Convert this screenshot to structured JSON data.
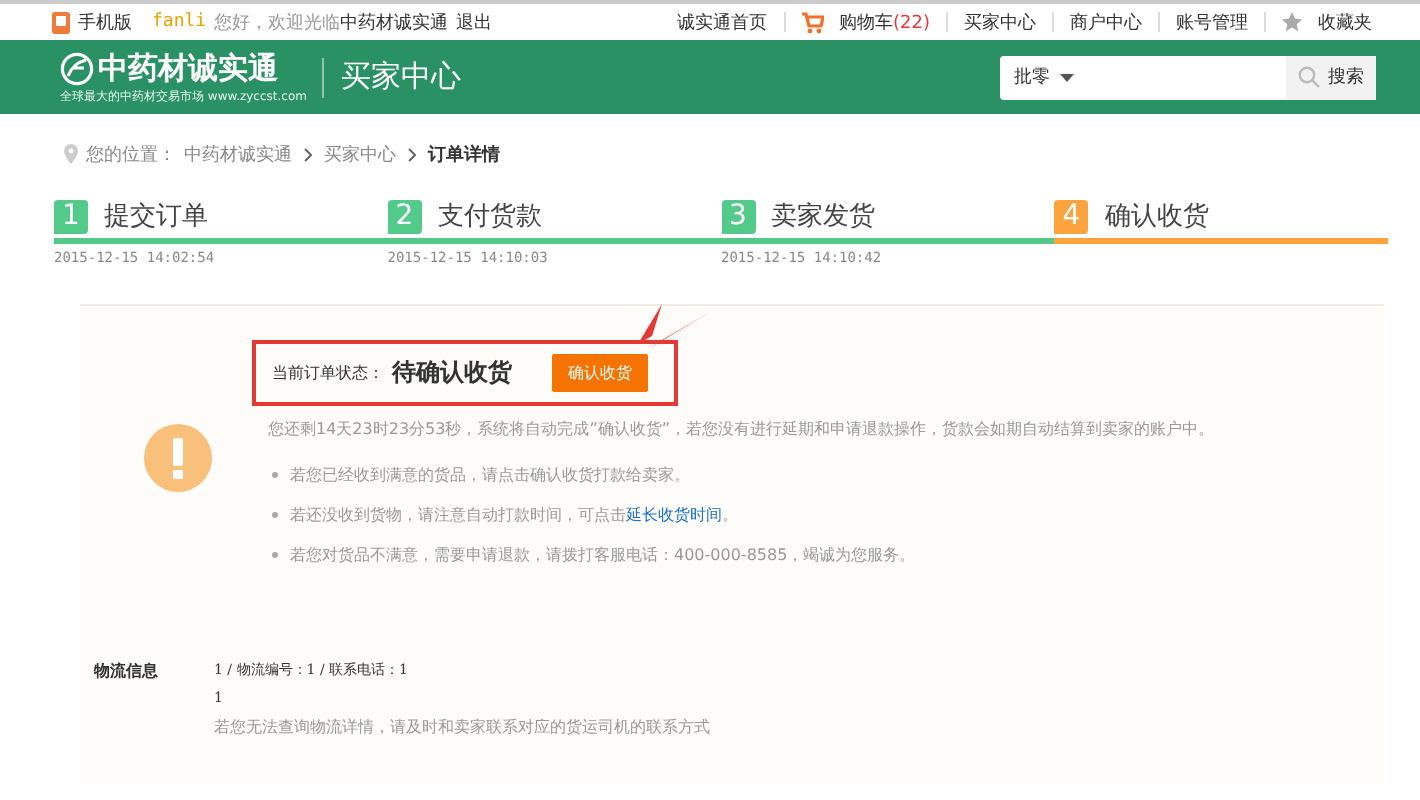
{
  "top_bar": {
    "mobile": "手机版",
    "user": "fanli",
    "greeting": "您好，欢迎光临",
    "site": "中药材诚实通",
    "logout": "退出",
    "links": [
      {
        "label": "诚实通首页",
        "kind": "plain"
      },
      {
        "label": "购物车",
        "count": "(22)",
        "kind": "cart"
      },
      {
        "label": "买家中心",
        "kind": "plain"
      },
      {
        "label": "商户中心",
        "kind": "plain"
      },
      {
        "label": "账号管理",
        "kind": "plain"
      },
      {
        "label": "收藏夹",
        "kind": "star"
      }
    ]
  },
  "header": {
    "logo": "中药材诚实通",
    "tagline": "全球最大的中药材交易市场 www.zyccst.com",
    "title": "买家中心",
    "search": {
      "scope": "批零",
      "button": "搜索"
    }
  },
  "breadcrumb": {
    "prefix": "您的位置：",
    "items": [
      "中药材诚实通",
      "买家中心",
      "订单详情"
    ]
  },
  "steps": [
    {
      "number": "1",
      "label": "提交订单",
      "time": "2015-12-15 14:02:54",
      "current": false
    },
    {
      "number": "2",
      "label": "支付货款",
      "time": "2015-12-15 14:10:03",
      "current": false
    },
    {
      "number": "3",
      "label": "卖家发货",
      "time": "2015-12-15 14:10:42",
      "current": false
    },
    {
      "number": "4",
      "label": "确认收货",
      "current": true
    }
  ],
  "status": {
    "label": "当前订单状态：",
    "value": "待确认收货",
    "button": "确认收货",
    "highlighted": true,
    "notice": "您还剩14天23时23分53秒，系统将自动完成”确认收货”，若您没有进行延期和申请退款操作，货款会如期自动结算到卖家的账户中。",
    "tips": [
      {
        "text": "若您已经收到满意的货品，请点击确认收货打款给卖家。"
      },
      {
        "text": "若还没收到货物，请注意自动打款时间，可点击",
        "link": "延长收货时间",
        "after": "。"
      },
      {
        "text": "若您对货品不满意，需要申请退款，请拨打客服电话：400-000-8585，竭诚为您服务。"
      }
    ]
  },
  "logistics": {
    "label": "物流信息",
    "line1": "1 / 物流编号：1 / 联系电话：1",
    "line2": "1",
    "note": "若您无法查询物流详情，请及时和卖家联系对应的货运司机的联系方式"
  }
}
